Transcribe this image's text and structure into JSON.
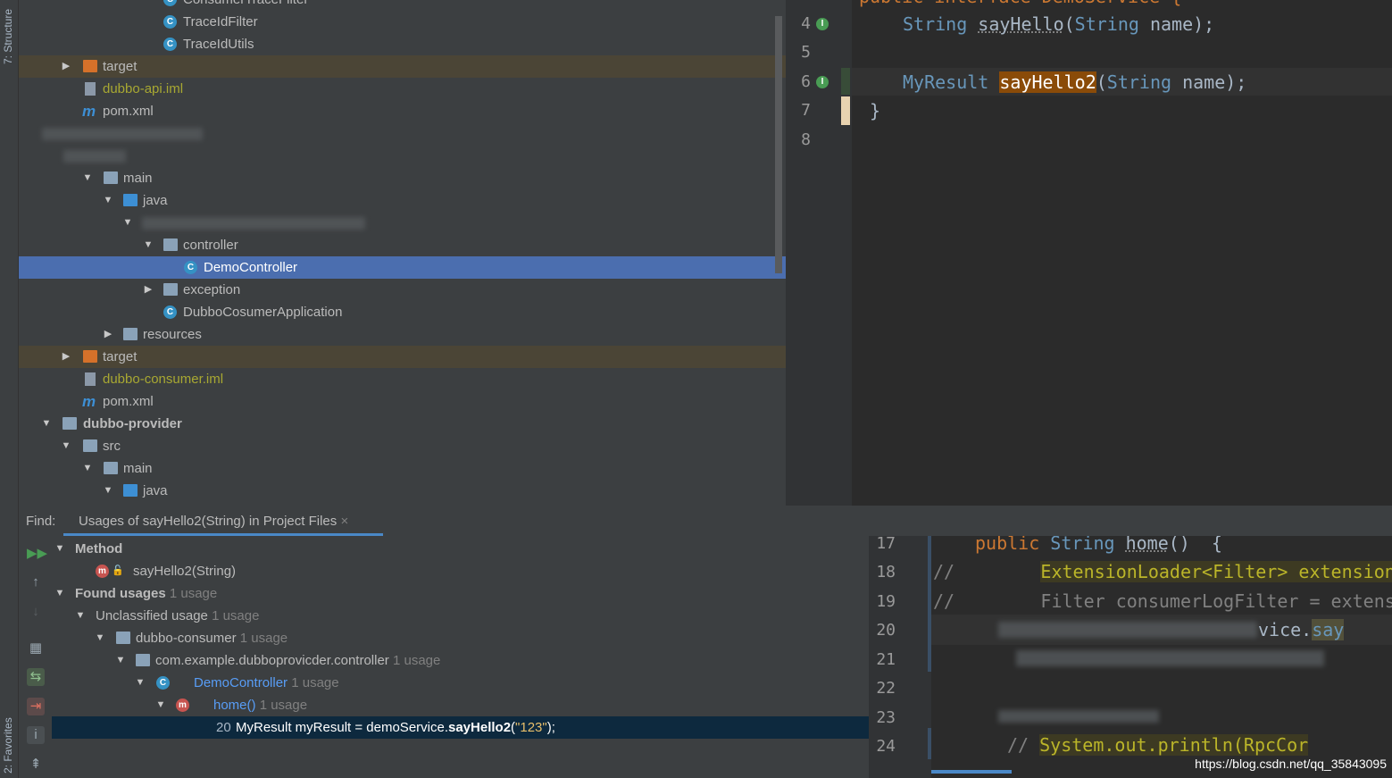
{
  "left_strip": {
    "structure_label": "7: Structure",
    "favorites_label": "2: Favorites"
  },
  "project_tree": {
    "rows": [
      {
        "label": "ConsumerTraceFilter"
      },
      {
        "label": "TraceIdFilter"
      },
      {
        "label": "TraceIdUtils"
      },
      {
        "label": "target"
      },
      {
        "label": "dubbo-api.iml"
      },
      {
        "label": "pom.xml"
      },
      {
        "label": "main"
      },
      {
        "label": "java"
      },
      {
        "label": "controller"
      },
      {
        "label": "DemoController"
      },
      {
        "label": "exception"
      },
      {
        "label": "DubboCosumerApplication"
      },
      {
        "label": "resources"
      },
      {
        "label": "target"
      },
      {
        "label": "dubbo-consumer.iml"
      },
      {
        "label": "pom.xml"
      },
      {
        "label": "dubbo-provider"
      },
      {
        "label": "src"
      },
      {
        "label": "main"
      },
      {
        "label": "java"
      }
    ],
    "icon_class": "C",
    "icon_maven": "m"
  },
  "editor": {
    "line_numbers": [
      "4",
      "5",
      "6",
      "7",
      "8"
    ],
    "line0": {
      "a": "public interface DemoService {"
    },
    "line4": {
      "type": "String",
      "method": "sayHello",
      "open": "(",
      "ptype": "String",
      "rest": " name);"
    },
    "line6": {
      "type": "MyResult",
      "method": "sayHello2",
      "open": "(",
      "ptype": "String",
      "rest": " name);"
    },
    "line7": {
      "brace": "}"
    }
  },
  "find": {
    "label": "Find:",
    "tab": "Usages of sayHello2(String) in Project Files",
    "close": "×",
    "rows": {
      "method_header": "Method",
      "method": "sayHello2(String)",
      "found": "Found usages",
      "found_count": "1 usage",
      "unclassified": "Unclassified usage",
      "unclassified_count": "1 usage",
      "module": "dubbo-consumer",
      "module_count": "1 usage",
      "package": "com.example.dubboprovicder.controller",
      "package_count": "1 usage",
      "class": "DemoController",
      "class_count": "1 usage",
      "method_home": "home()",
      "home_count": "1 usage",
      "usage_line": "20",
      "usage_pre": "MyResult myResult = demoService.",
      "usage_match": "sayHello2",
      "usage_open": "(",
      "usage_str": "\"123\"",
      "usage_close": ");"
    }
  },
  "preview": {
    "line_numbers": [
      "17",
      "18",
      "19",
      "20",
      "21",
      "22",
      "23",
      "24"
    ],
    "l17": {
      "kw": "public",
      "type": "String",
      "name": "home",
      "rest": "()  {"
    },
    "l18": {
      "c": "//",
      "code": "ExtensionLoader<Filter> extension"
    },
    "l19": {
      "c": "//",
      "code": "Filter consumerLogFilter = extens"
    },
    "l20": {
      "code": "vice.",
      "tail": "say"
    },
    "l24": {
      "c": "// ",
      "code": "System.out.println(RpcCor"
    }
  },
  "watermark": "https://blog.csdn.net/qq_35843095"
}
